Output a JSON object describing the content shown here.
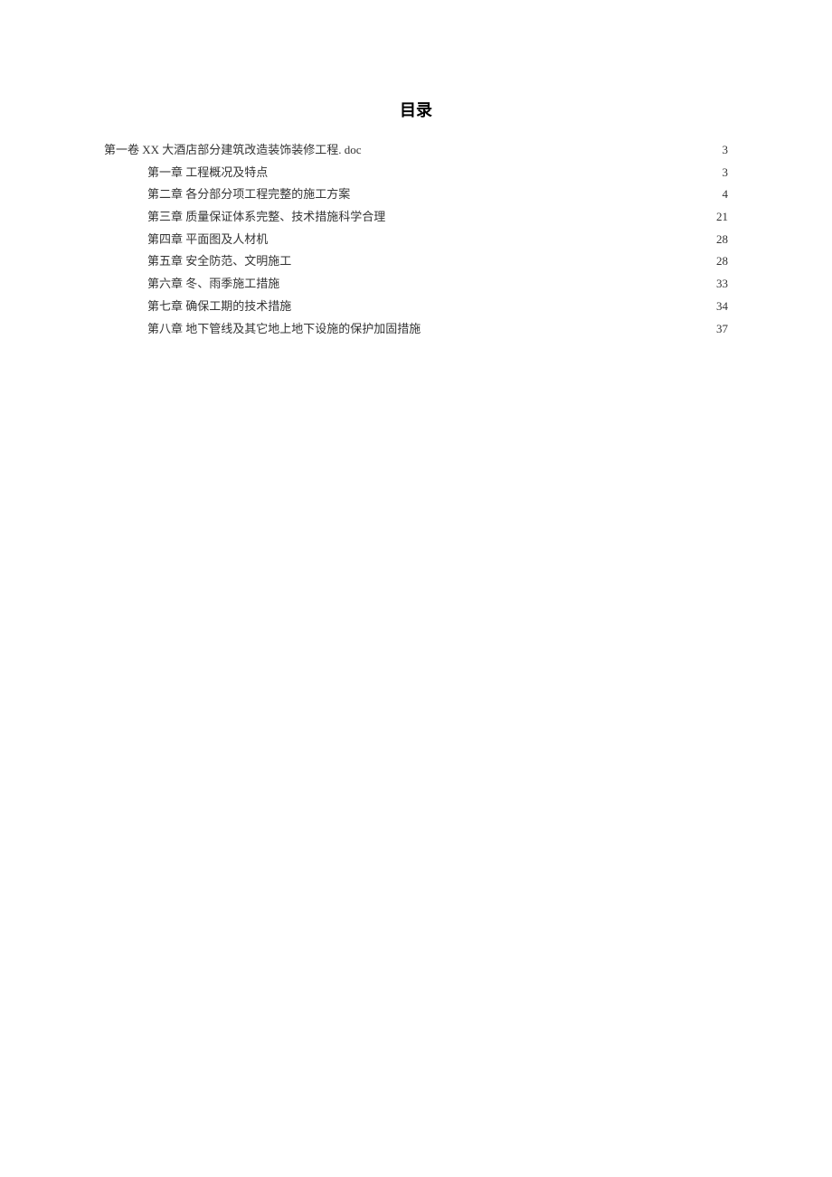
{
  "title": "目录",
  "toc": [
    {
      "level": 0,
      "text": "第一卷 XX 大酒店部分建筑改造装饰装修工程. doc",
      "page": "3"
    },
    {
      "level": 1,
      "text": "第一章 工程概况及特点",
      "page": "3"
    },
    {
      "level": 1,
      "text": "第二章 各分部分项工程完整的施工方案",
      "page": "4"
    },
    {
      "level": 1,
      "text": "第三章 质量保证体系完整、技术措施科学合理",
      "page": "21"
    },
    {
      "level": 1,
      "text": "第四章 平面图及人材机",
      "page": "28"
    },
    {
      "level": 1,
      "text": "第五章 安全防范、文明施工",
      "page": "28"
    },
    {
      "level": 1,
      "text": "第六章 冬、雨季施工措施",
      "page": "33"
    },
    {
      "level": 1,
      "text": "第七章 确保工期的技术措施",
      "page": "34"
    },
    {
      "level": 1,
      "text": "第八章 地下管线及其它地上地下设施的保护加固措施",
      "page": "37"
    }
  ]
}
